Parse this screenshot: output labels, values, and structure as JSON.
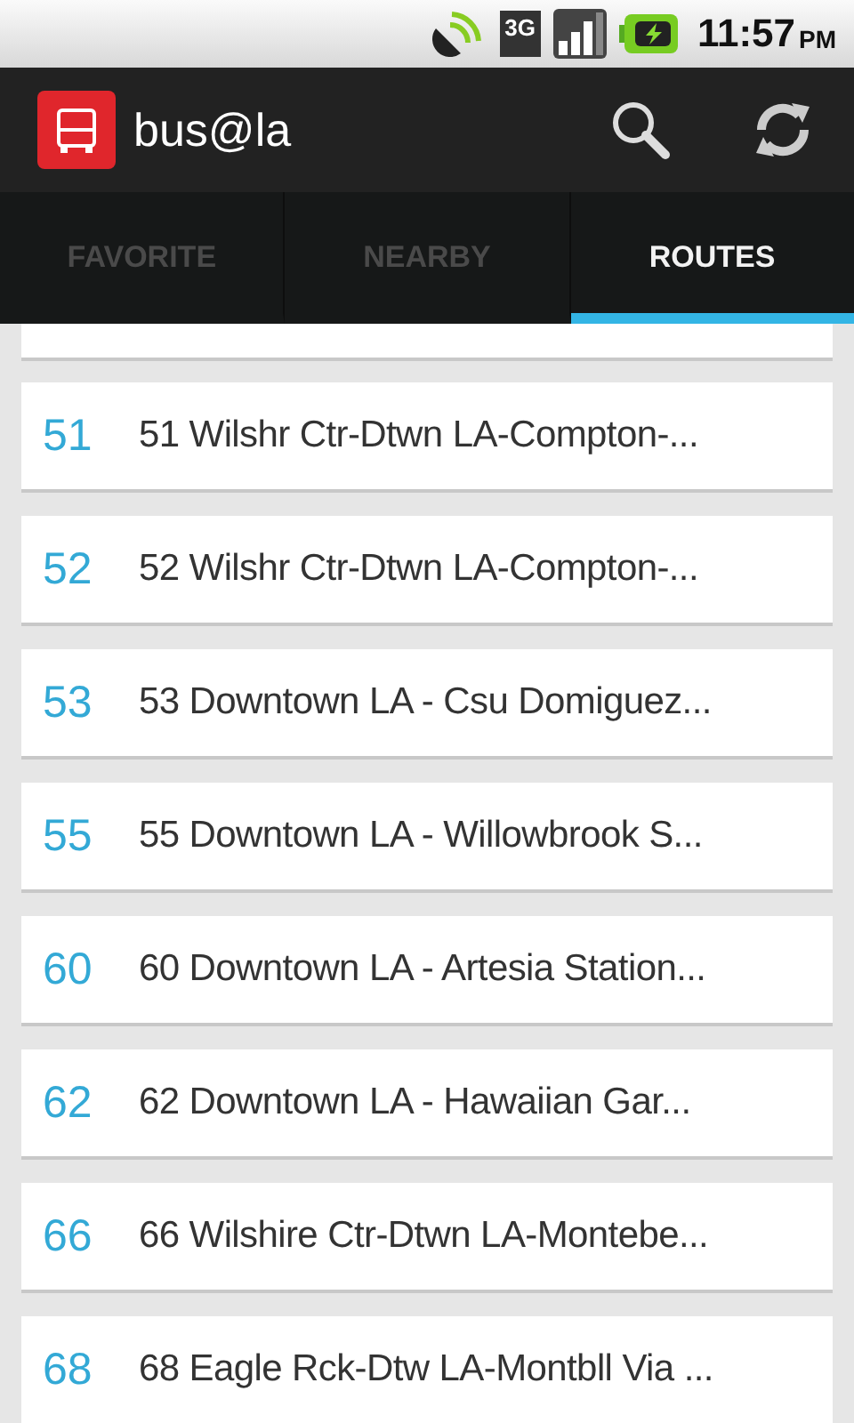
{
  "status_bar": {
    "network": "3G",
    "time": "11:57",
    "meridiem": "PM"
  },
  "action_bar": {
    "title": "bus@la"
  },
  "tabs": [
    {
      "label": "FAVORITE",
      "selected": false
    },
    {
      "label": "NEARBY",
      "selected": false
    },
    {
      "label": "ROUTES",
      "selected": true
    }
  ],
  "routes": [
    {
      "number": "51",
      "name": "51 Wilshr Ctr-Dtwn LA-Compton-..."
    },
    {
      "number": "52",
      "name": "52 Wilshr Ctr-Dtwn LA-Compton-..."
    },
    {
      "number": "53",
      "name": "53 Downtown LA - Csu Domiguez..."
    },
    {
      "number": "55",
      "name": "55 Downtown LA - Willowbrook S..."
    },
    {
      "number": "60",
      "name": "60 Downtown LA - Artesia Station..."
    },
    {
      "number": "62",
      "name": "62 Downtown LA - Hawaiian Gar..."
    },
    {
      "number": "66",
      "name": "66 Wilshire Ctr-Dtwn LA-Montebe..."
    },
    {
      "number": "68",
      "name": "68 Eagle Rck-Dtw LA-Montbll Via ..."
    }
  ]
}
